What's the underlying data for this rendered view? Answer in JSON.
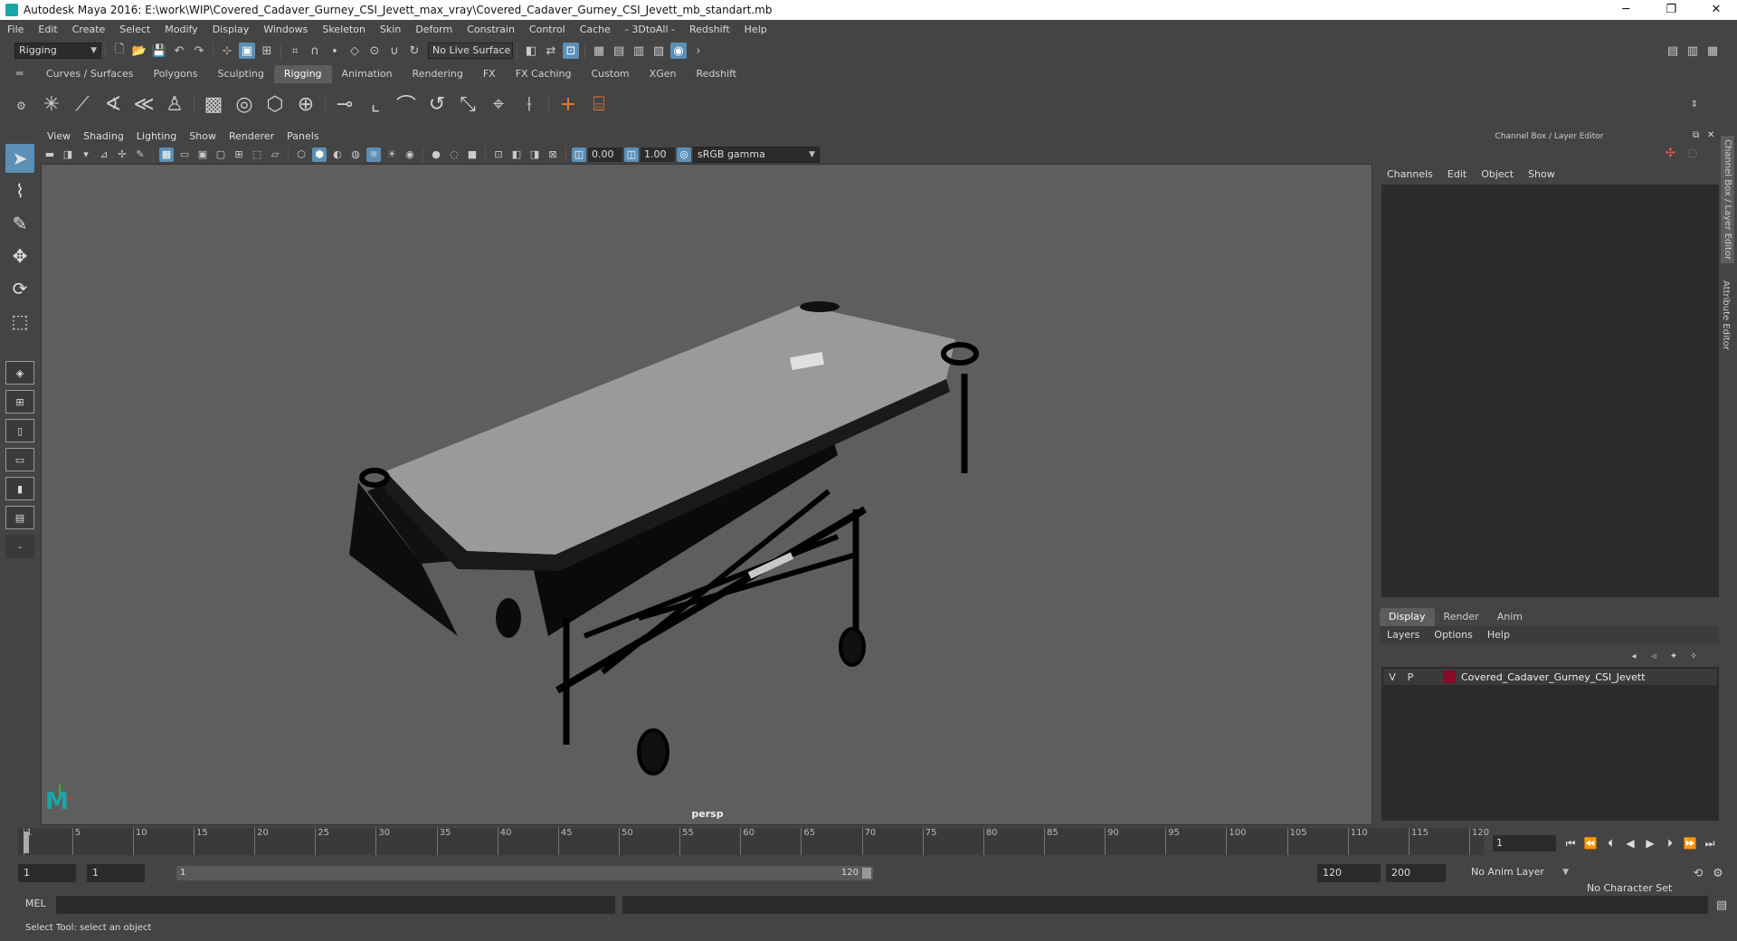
{
  "window": {
    "title": "Autodesk Maya 2016: E:\\work\\WIP\\Covered_Cadaver_Gurney_CSI_Jevett_max_vray\\Covered_Cadaver_Gurney_CSI_Jevett_mb_standart.mb",
    "minimize": "─",
    "restore": "❐",
    "close": "✕"
  },
  "menubar": [
    "File",
    "Edit",
    "Create",
    "Select",
    "Modify",
    "Display",
    "Windows",
    "Skeleton",
    "Skin",
    "Deform",
    "Constrain",
    "Control",
    "Cache",
    "- 3DtoAll -",
    "Redshift",
    "Help"
  ],
  "statusline": {
    "mode": "Rigging",
    "live_surface": "No Live Surface"
  },
  "shelf": {
    "tabs": [
      "Curves / Surfaces",
      "Polygons",
      "Sculpting",
      "Rigging",
      "Animation",
      "Rendering",
      "FX",
      "FX Caching",
      "Custom",
      "XGen",
      "Redshift"
    ],
    "active_tab": "Rigging"
  },
  "viewport": {
    "menu": [
      "View",
      "Shading",
      "Lighting",
      "Show",
      "Renderer",
      "Panels"
    ],
    "exposure": "0.00",
    "gamma": "1.00",
    "color_space": "sRGB gamma",
    "camera_label": "persp"
  },
  "channel_box": {
    "header": "Channel Box / Layer Editor",
    "menu": [
      "Channels",
      "Edit",
      "Object",
      "Show"
    ],
    "side_tabs": [
      "Channel Box / Layer Editor",
      "Attribute Editor"
    ]
  },
  "layer_editor": {
    "tabs": [
      "Display",
      "Render",
      "Anim"
    ],
    "active_tab": "Display",
    "menu": [
      "Layers",
      "Options",
      "Help"
    ],
    "layers": [
      {
        "v": "V",
        "p": "P",
        "name": "Covered_Cadaver_Gurney_CSI_Jevett",
        "color": "#8a0a2a"
      }
    ]
  },
  "timeline": {
    "start": 1,
    "end": 120,
    "labels": [
      "1",
      "5",
      "10",
      "15",
      "20",
      "25",
      "30",
      "35",
      "40",
      "45",
      "50",
      "55",
      "60",
      "65",
      "70",
      "75",
      "80",
      "85",
      "90",
      "95",
      "100",
      "105",
      "110",
      "115",
      "120"
    ],
    "current_frame": "1"
  },
  "range": {
    "start_field": "1",
    "playback_start": "1",
    "slider_start": "1",
    "slider_end": "120",
    "playback_end": "120",
    "end_field": "200",
    "anim_layer": "No Anim Layer",
    "character_set": "No Character Set"
  },
  "command_line": {
    "label": "MEL"
  },
  "help_line": "Select Tool: select an object"
}
